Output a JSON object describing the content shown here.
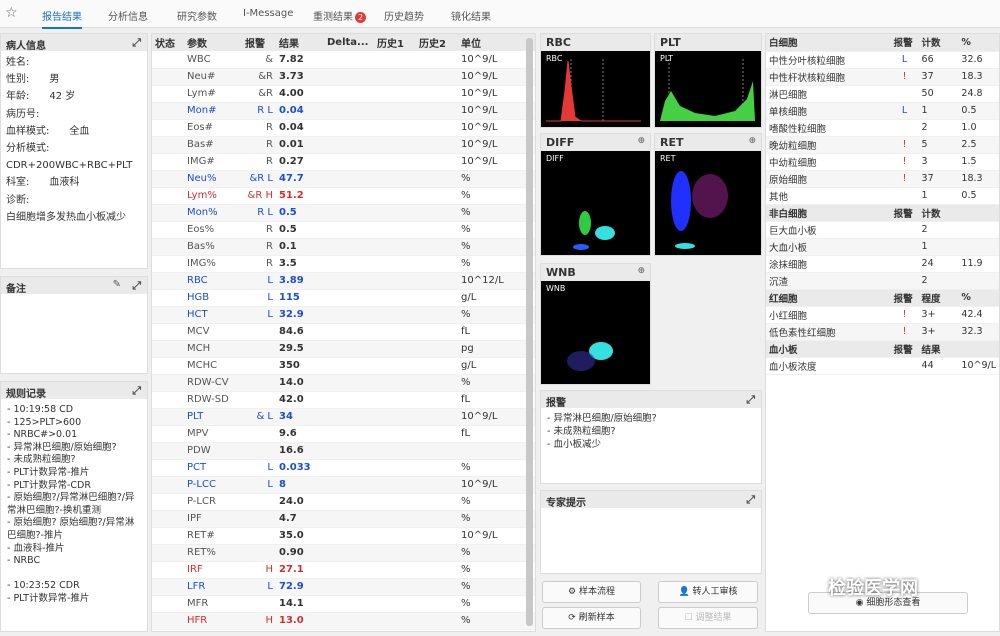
{
  "tabs": [
    "报告结果",
    "分析信息",
    "研究参数",
    "I-Message",
    "重测结果",
    "历史趋势",
    "镜化结果"
  ],
  "retest_badge": "2",
  "patient": {
    "title": "病人信息",
    "rows": [
      "姓名:",
      "性别:　　男",
      "年龄:　　42 岁",
      "病历号:",
      "血样模式:　　全血",
      "分析模式:",
      "CDR+200WBC+RBC+PLT",
      "科室:　　血液科",
      "诊断:",
      "白细胞增多发热血小板减少"
    ]
  },
  "notes": {
    "title": "备注"
  },
  "rules": {
    "title": "规则记录",
    "text": "- 10:19:58 CD\n- 125>PLT>600\n- NRBC#>0.01\n- 异常淋巴细胞/原始细胞?\n- 未成熟粒细胞?\n- PLT计数异常-推片\n- PLT计数异常-CDR\n- 原始细胞?/异常淋巴细胞?/异常淋巴细胞?-换机重测\n- 原始细胞? 原始细胞?/异常淋巴细胞?-推片\n- 血液科-推片\n- NRBC\n\n- 10:23:52 CDR\n- PLT计数异常-推片"
  },
  "results": {
    "headers": [
      "状态",
      "参数",
      "报警",
      "结果",
      "Delta...",
      "历史1",
      "历史2",
      "单位"
    ],
    "rows": [
      [
        "",
        "WBC",
        "&",
        "7.82",
        "",
        "",
        "",
        "10^9/L",
        ""
      ],
      [
        "",
        "Neu#",
        "&R",
        "3.73",
        "",
        "",
        "",
        "10^9/L",
        ""
      ],
      [
        "",
        "Lym#",
        "&R",
        "4.00",
        "",
        "",
        "",
        "10^9/L",
        ""
      ],
      [
        "",
        "Mon#",
        "R L",
        "0.04",
        "",
        "",
        "",
        "10^9/L",
        "blue"
      ],
      [
        "",
        "Eos#",
        "R",
        "0.04",
        "",
        "",
        "",
        "10^9/L",
        ""
      ],
      [
        "",
        "Bas#",
        "R",
        "0.01",
        "",
        "",
        "",
        "10^9/L",
        ""
      ],
      [
        "",
        "IMG#",
        "R",
        "0.27",
        "",
        "",
        "",
        "10^9/L",
        ""
      ],
      [
        "",
        "Neu%",
        "&R L",
        "47.7",
        "",
        "",
        "",
        "%",
        "blue"
      ],
      [
        "",
        "Lym%",
        "&R H",
        "51.2",
        "",
        "",
        "",
        "%",
        "red"
      ],
      [
        "",
        "Mon%",
        "R L",
        "0.5",
        "",
        "",
        "",
        "%",
        "blue"
      ],
      [
        "",
        "Eos%",
        "R",
        "0.5",
        "",
        "",
        "",
        "%",
        ""
      ],
      [
        "",
        "Bas%",
        "R",
        "0.1",
        "",
        "",
        "",
        "%",
        ""
      ],
      [
        "",
        "IMG%",
        "R",
        "3.5",
        "",
        "",
        "",
        "%",
        ""
      ],
      [
        "",
        "RBC",
        "L",
        "3.89",
        "",
        "",
        "",
        "10^12/L",
        "blue"
      ],
      [
        "",
        "HGB",
        "L",
        "115",
        "",
        "",
        "",
        "g/L",
        "blue"
      ],
      [
        "",
        "HCT",
        "L",
        "32.9",
        "",
        "",
        "",
        "%",
        "blue"
      ],
      [
        "",
        "MCV",
        "",
        "84.6",
        "",
        "",
        "",
        "fL",
        ""
      ],
      [
        "",
        "MCH",
        "",
        "29.5",
        "",
        "",
        "",
        "pg",
        ""
      ],
      [
        "",
        "MCHC",
        "",
        "350",
        "",
        "",
        "",
        "g/L",
        ""
      ],
      [
        "",
        "RDW-CV",
        "",
        "14.0",
        "",
        "",
        "",
        "%",
        ""
      ],
      [
        "",
        "RDW-SD",
        "",
        "42.0",
        "",
        "",
        "",
        "fL",
        ""
      ],
      [
        "",
        "PLT",
        "& L",
        "34",
        "",
        "",
        "",
        "10^9/L",
        "blue"
      ],
      [
        "",
        "MPV",
        "",
        "9.6",
        "",
        "",
        "",
        "fL",
        ""
      ],
      [
        "",
        "PDW",
        "",
        "16.6",
        "",
        "",
        "",
        "",
        ""
      ],
      [
        "",
        "PCT",
        "L",
        "0.033",
        "",
        "",
        "",
        "%",
        "blue"
      ],
      [
        "",
        "P-LCC",
        "L",
        "8",
        "",
        "",
        "",
        "10^9/L",
        "blue"
      ],
      [
        "",
        "P-LCR",
        "",
        "24.0",
        "",
        "",
        "",
        "%",
        ""
      ],
      [
        "",
        "IPF",
        "",
        "4.7",
        "",
        "",
        "",
        "%",
        ""
      ],
      [
        "",
        "RET#",
        "",
        "35.0",
        "",
        "",
        "",
        "10^9/L",
        ""
      ],
      [
        "",
        "RET%",
        "",
        "0.90",
        "",
        "",
        "",
        "%",
        ""
      ],
      [
        "",
        "IRF",
        "H",
        "27.1",
        "",
        "",
        "",
        "%",
        "red"
      ],
      [
        "",
        "LFR",
        "L",
        "72.9",
        "",
        "",
        "",
        "%",
        "blue"
      ],
      [
        "",
        "MFR",
        "",
        "14.1",
        "",
        "",
        "",
        "%",
        ""
      ],
      [
        "",
        "HFR",
        "H",
        "13.0",
        "",
        "",
        "",
        "%",
        "red"
      ]
    ]
  },
  "graphs": {
    "rbc": "RBC",
    "plt": "PLT",
    "diff": "DIFF",
    "ret": "RET",
    "wnb": "WNB",
    "rbc_inner": "RBC",
    "plt_inner": "PLT",
    "diff_inner": "DIFF",
    "ret_inner": "RET",
    "wnb_inner": "WNB",
    "rbc_ticks": [
      "0",
      "100",
      "200",
      "fL"
    ],
    "plt_ticks": [
      "0",
      "10",
      "20",
      "fL"
    ]
  },
  "alarms": {
    "title": "报警",
    "items": [
      "- 异常淋巴细胞/原始细胞?",
      "- 未成熟粒细胞?",
      "- 血小板减少"
    ]
  },
  "expert": {
    "title": "专家提示"
  },
  "buttons": {
    "flow": "样本流程",
    "manual": "转人工审核",
    "refresh": "刷新样本",
    "adjust": "调整结果",
    "view": "细胞形态查看"
  },
  "cells": {
    "wbc_head": [
      "白细胞",
      "报警",
      "计数",
      "%"
    ],
    "wbc": [
      [
        "中性分叶核粒细胞",
        "L",
        "66",
        "32.6"
      ],
      [
        "中性杆状核粒细胞",
        "!",
        "37",
        "18.3"
      ],
      [
        "淋巴细胞",
        "",
        "50",
        "24.8"
      ],
      [
        "单核细胞",
        "L",
        "1",
        "0.5"
      ],
      [
        "嗜酸性粒细胞",
        "",
        "2",
        "1.0"
      ],
      [
        "晚幼粒细胞",
        "!",
        "5",
        "2.5"
      ],
      [
        "中幼粒细胞",
        "!",
        "3",
        "1.5"
      ],
      [
        "原始细胞",
        "!",
        "37",
        "18.3"
      ],
      [
        "其他",
        "",
        "1",
        "0.5"
      ]
    ],
    "non_head": [
      "非白细胞",
      "报警",
      "计数",
      ""
    ],
    "non": [
      [
        "巨大血小板",
        "",
        "2",
        ""
      ],
      [
        "大血小板",
        "",
        "1",
        ""
      ],
      [
        "涂抹细胞",
        "",
        "24",
        "11.9"
      ],
      [
        "沉渣",
        "",
        "2",
        ""
      ]
    ],
    "rbc_head": [
      "红细胞",
      "报警",
      "程度",
      "%"
    ],
    "rbc": [
      [
        "小红细胞",
        "!",
        "3+",
        "42.4"
      ],
      [
        "低色素性红细胞",
        "!",
        "3+",
        "32.3"
      ]
    ],
    "plt_head": [
      "血小板",
      "报警",
      "结果",
      ""
    ],
    "plt": [
      [
        "血小板浓度",
        "",
        "44",
        "10^9/L"
      ]
    ]
  },
  "watermark": "检验医学网"
}
